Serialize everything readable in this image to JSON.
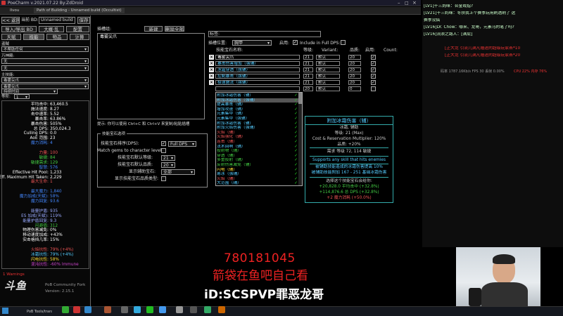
{
  "titlebar": {
    "app": "PoeCharm v.2021.07.22 By:ZdDroid",
    "tab_left": "Ilvou",
    "tab_main": "Path of Building - Unnamed build (Occultist)"
  },
  "left": {
    "top_buttons": {
      "back": "<< 返回",
      "current_bd_label": "当前 BD:",
      "build_name": "Unnamed build",
      "save": "保存",
      "import_export": "导入/导出 BD",
      "notes": "大概·乱",
      "config": "配置"
    },
    "tabs": {
      "tree": "天赋",
      "skills": "技能",
      "items": "物品",
      "calcs": "计算"
    },
    "selectors": {
      "bandit_label": "盗贼",
      "bandit_val": "不帮助任何",
      "pantheon_major_label": "万神殿:",
      "pantheon_major_val": "无",
      "pantheon_minor_val": "无",
      "main_skill_label": "主技能:",
      "main_skill_val": "毒雾尖爪",
      "sub_val": "毒雾尖爪",
      "mode_val": "持续时间",
      "aura_label": "等阶:",
      "aura_val": "1"
    },
    "stats": [
      {
        "k": "平均击中:",
        "v": "63,460.5",
        "c": "#fff"
      },
      {
        "k": "施法速度:",
        "v": "8.27",
        "c": "#fff"
      },
      {
        "k": "击中速率:",
        "v": "5.52",
        "c": "#fff"
      },
      {
        "k": "暴击率:",
        "v": "63.86%",
        "c": "#fff"
      },
      {
        "k": "暴击伤害:",
        "v": "505%",
        "c": "#fff"
      },
      {
        "k": "总 DPS:",
        "v": "350,024.3",
        "c": "#fff"
      },
      {
        "k": "Culling DPS:",
        "v": "0.0",
        "c": "#fff"
      },
      {
        "k": "AoE 范围:",
        "v": "23",
        "c": "#fff"
      },
      {
        "k": "魔力消耗:",
        "v": "4",
        "c": "#48f"
      },
      {
        "k": "",
        "v": "",
        "c": "#fff"
      },
      {
        "k": "力量:",
        "v": "100",
        "c": "#e55"
      },
      {
        "k": "敏捷:",
        "v": "84",
        "c": "#4c4"
      },
      {
        "k": "敏捷需求:",
        "v": "129",
        "c": "#4c4"
      },
      {
        "k": "智慧:",
        "v": "576",
        "c": "#48f"
      },
      {
        "k": "Effective Hit Pool:",
        "v": "1,233",
        "c": "#fff"
      },
      {
        "k": "Eff. Maximum Hit Taken:",
        "v": "2,229",
        "c": "#fff"
      },
      {
        "k": "最大生命:",
        "v": "1",
        "c": "#e55"
      },
      {
        "k": "",
        "v": "",
        "c": "#fff"
      },
      {
        "k": "最大魔力:",
        "v": "1,840",
        "c": "#48f"
      },
      {
        "k": "魔力加成(天赋):",
        "v": "58%",
        "c": "#48f"
      },
      {
        "k": "魔力回复:",
        "v": "93.6",
        "c": "#48f"
      },
      {
        "k": "",
        "v": "",
        "c": "#fff"
      },
      {
        "k": "能量护盾:",
        "v": "935",
        "c": "#9af"
      },
      {
        "k": "ES 加成(天赋):",
        "v": "119%",
        "c": "#9af"
      },
      {
        "k": "能量护盾回复:",
        "v": "9.3",
        "c": "#9af"
      },
      {
        "k": "闪避值:",
        "v": "312",
        "c": "#4c4"
      },
      {
        "k": "物理伤害减免:",
        "v": "0%",
        "c": "#fff"
      },
      {
        "k": "移动速度加成:",
        "v": "+43%",
        "c": "#fff"
      },
      {
        "k": "实击格挡几率:",
        "v": "15%",
        "c": "#fff"
      },
      {
        "k": "",
        "v": "",
        "c": "#fff"
      },
      {
        "k": "火焰抗性:",
        "v": "79% (+4%)",
        "c": "#e55"
      },
      {
        "k": "冰霜抗性:",
        "v": "79% (+4%)",
        "c": "#5cf"
      },
      {
        "k": "闪电抗性:",
        "v": "58%",
        "c": "#fd3"
      },
      {
        "k": "混沌抗性:",
        "v": "-60% Immune",
        "c": "#c4c"
      }
    ],
    "warning": "1 Warnings",
    "footer_app": "PoB Community Fork",
    "footer_ver": "Version: 2.15.1"
  },
  "skills": {
    "header_label": "插槽组:",
    "new_btn": "新建",
    "delete_all_btn": "删除全部",
    "group_selected": "毒雾尖爪",
    "hint": "提示: 你可以使用 Ctrl+C 和 Ctrl+V 来复制/粘贴插槽",
    "label_field": "标签:",
    "slot_label": "插槽位置:",
    "slot_val": "胸甲",
    "enabled_label": "启用:",
    "include_full_dps": "Include in Full DPS:",
    "cols": {
      "name": "技能宝石名称:",
      "level": "等级:",
      "variant": "Variant:",
      "quality": "品质:",
      "enabled": "启用:",
      "count": "Count:"
    },
    "gems": [
      {
        "name": "毒雾尖爪",
        "level": "21",
        "variant": "默认",
        "quality": "20"
      },
      {
        "name": "暴击伤害增加（强辅）",
        "level": "21",
        "variant": "默认",
        "quality": "20"
      },
      {
        "name": "冰霜穿透（强辅）",
        "level": "21",
        "variant": "默认",
        "quality": "20"
      },
      {
        "name": "控制暴击（强辅）",
        "level": "21",
        "variant": "默认",
        "quality": "20"
      },
      {
        "name": "极速施法（强辅）",
        "level": "21",
        "variant": "默认",
        "quality": "20"
      },
      {
        "name": "",
        "level": "20",
        "variant": "默认",
        "quality": "0"
      }
    ],
    "dropdown_items": [
      {
        "t": "附加冰霜伤害（辅）",
        "c": "#5cf",
        "sel": false
      },
      {
        "t": "附加冰霜伤害（强辅）",
        "c": "#5cf",
        "sel": true
      },
      {
        "t": "提高暴击（辅）",
        "c": "#5cf",
        "sel": false
      },
      {
        "t": "增加攻速（辅）",
        "c": "#5cf",
        "sel": false
      },
      {
        "t": "元素集中（辅）",
        "c": "#5cf",
        "sel": false
      },
      {
        "t": "元素集中（强辅）",
        "c": "#5cf",
        "sel": false
      },
      {
        "t": "附加冰霜伤害（辅）",
        "c": "#5cf",
        "sel": false
      },
      {
        "t": "附加火焰伤害（强辅）",
        "c": "#5cf",
        "sel": false
      },
      {
        "t": "火焰（辅）",
        "c": "#e55",
        "sel": false
      },
      {
        "t": "火焰强化（辅）",
        "c": "#e55",
        "sel": false
      },
      {
        "t": "连击（辅）",
        "c": "#e55",
        "sel": false
      },
      {
        "t": "法术回响（辅）",
        "c": "#5cf",
        "sel": false
      },
      {
        "t": "投射物（辅）",
        "c": "#4c4",
        "sel": false
      },
      {
        "t": "穿透（辅）",
        "c": "#4c4",
        "sel": false
      },
      {
        "t": "多重投射（辅）",
        "c": "#4c4",
        "sel": false
      },
      {
        "t": "反射伤害减免（辅）",
        "c": "#4c4",
        "sel": false
      },
      {
        "t": "闪电（辅）",
        "c": "#fd3",
        "sel": false
      },
      {
        "t": "寒冰（强辅）",
        "c": "#5cf",
        "sel": false
      },
      {
        "t": "火焰（辅）",
        "c": "#e55",
        "sel": false
      },
      {
        "t": "大范围（辅）",
        "c": "#5cf",
        "sel": false
      }
    ],
    "options": {
      "title": "技能宝石选项",
      "sort_label": "技能宝石排序(DPS):",
      "sort_val": "Full DPS",
      "match_label": "Match gems to character level:",
      "default_level_label": "技能宝石默认等级:",
      "default_level_val": "21",
      "default_quality_label": "技能宝石默认品质:",
      "default_quality_val": "20",
      "show_support_label": "显示辅助宝石:",
      "show_support_val": "全部",
      "show_quality_label": "显示技能宝石品质类型:"
    }
  },
  "tooltip": {
    "title": "附加冰霜伤害（辅）",
    "lines": [
      {
        "t": "冰霜, 辅助",
        "c": "#ccc"
      },
      {
        "t": "等级: 21 (Max)",
        "c": "#ccc"
      },
      {
        "t": "Cost & Reservation Multiplier: 120%",
        "c": "#ccc"
      },
      {
        "t": "品质: +20%",
        "c": "#ccc"
      },
      {
        "t": "需求 等级 72, 114 敏捷",
        "c": "#ccc"
      },
      {
        "t": "Supports any skill that hits enemies",
        "c": "#5cf"
      },
      {
        "t": "被辅助技能造成的冰霜伤害提高 10%",
        "c": "#5cf"
      },
      {
        "t": "被辅助技能附加 167 - 251 基础冰霜伤害",
        "c": "#5cf"
      },
      {
        "t": "选择这个技能宝石会给你:",
        "c": "#ccc"
      },
      {
        "t": "+20,828.0 平均击中 (+32.8%)",
        "c": "#4c4"
      },
      {
        "t": "+114,876.6 总 DPS (+32.8%)",
        "c": "#4c4"
      },
      {
        "t": "+2 魔力消耗 (+50.0%)",
        "c": "#e55"
      }
    ]
  },
  "chat": {
    "lines": [
      {
        "t": "[LV1]十三妈咪：合金戒指?",
        "c": "#cfc"
      },
      {
        "t": "[LV21]十三妈咪：冬扶我上个赛季玩用刷透刷了 这",
        "c": "#cfc"
      },
      {
        "t": "赛季没搞",
        "c": "#cfc"
      },
      {
        "t": "[LV16]Dr. Chow：哪来、龙哥，元素马的笔了吗?",
        "c": "#cfc"
      },
      {
        "t": "[LV16]流浪之路人：[满屁]",
        "c": "#cfc"
      }
    ],
    "gifts": [
      {
        "t": "[正大龙 引流儿满凡赠送的超级玩家燕*10",
        "c": "#e33"
      },
      {
        "t": "[正大龙 引流儿满凡赠送的超级玩家燕*20",
        "c": "#e33"
      }
    ],
    "fps_line": "码率 1787.16Kb/s FPS 30  丢帧 0.00%",
    "cpu_line": "CPU 22%  内存 76%"
  },
  "overlay": {
    "qq": "780181045",
    "line2": "箭袋在鱼吧自己看",
    "line3": "iD:SCSPVP罪恶龙哥"
  },
  "taskbar": {
    "window_title": "PoB Tools/translate_..."
  },
  "logo": "斗鱼"
}
